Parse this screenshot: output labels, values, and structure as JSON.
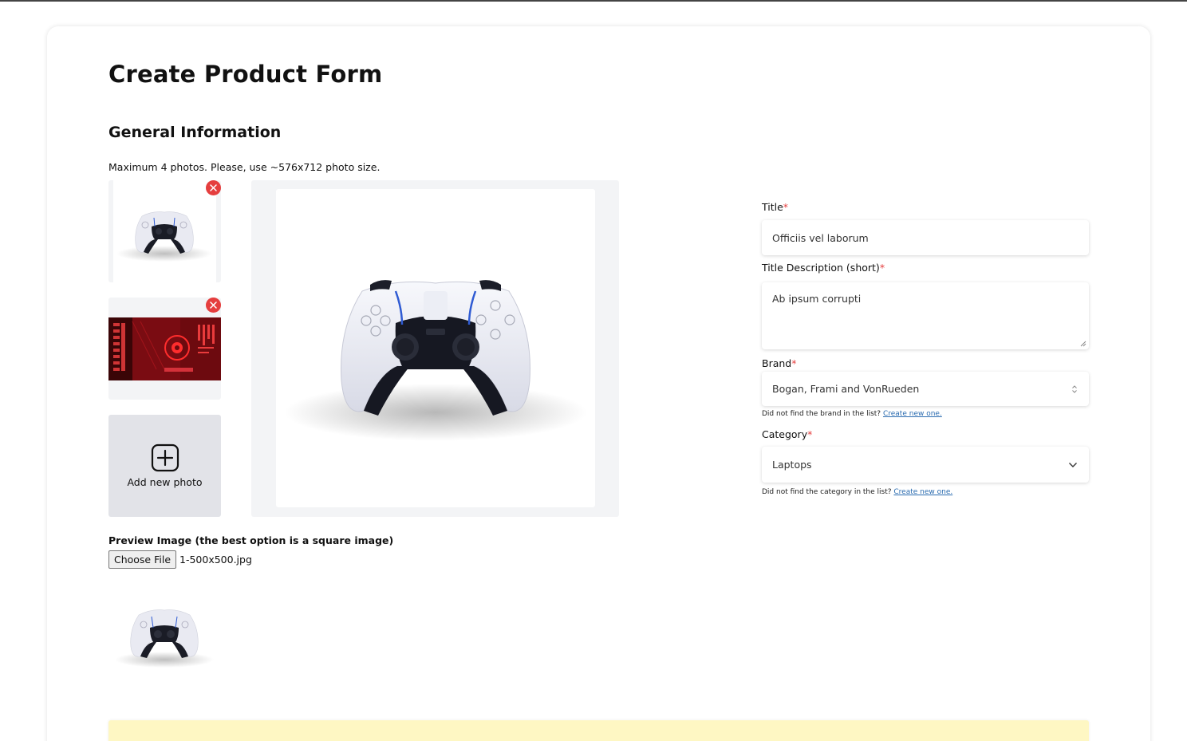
{
  "page": {
    "title": "Create Product Form",
    "section_title": "General Information",
    "photo_hint": "Maximum 4 photos. Please, use ~576x712 photo size."
  },
  "photos": {
    "add_label": "Add new photo",
    "remove_icon": "close-circle-icon",
    "items": [
      {
        "kind": "controller-image"
      },
      {
        "kind": "red-banner-image"
      }
    ]
  },
  "preview": {
    "label": "Preview Image (the best option is a square image)",
    "choose_file_label": "Choose File",
    "file_name": "1-500x500.jpg"
  },
  "form": {
    "title_label": "Title",
    "title_value": "Officiis vel laborum",
    "title_desc_label": "Title Description (short)",
    "title_desc_value": "Ab ipsum corrupti",
    "brand_label": "Brand",
    "brand_value": "Bogan, Frami and VonRueden",
    "brand_helper": "Did not find the brand in the list?",
    "brand_helper_link": "Create new one.",
    "category_label": "Category",
    "category_value": "Laptops",
    "category_helper": "Did not find the category in the list?",
    "category_helper_link": "Create new one.",
    "required_mark": "*"
  },
  "colors": {
    "required": "#e53e3e",
    "link": "#2b6cb0",
    "banner": "#fef7c3",
    "panel": "#f3f4f6"
  }
}
